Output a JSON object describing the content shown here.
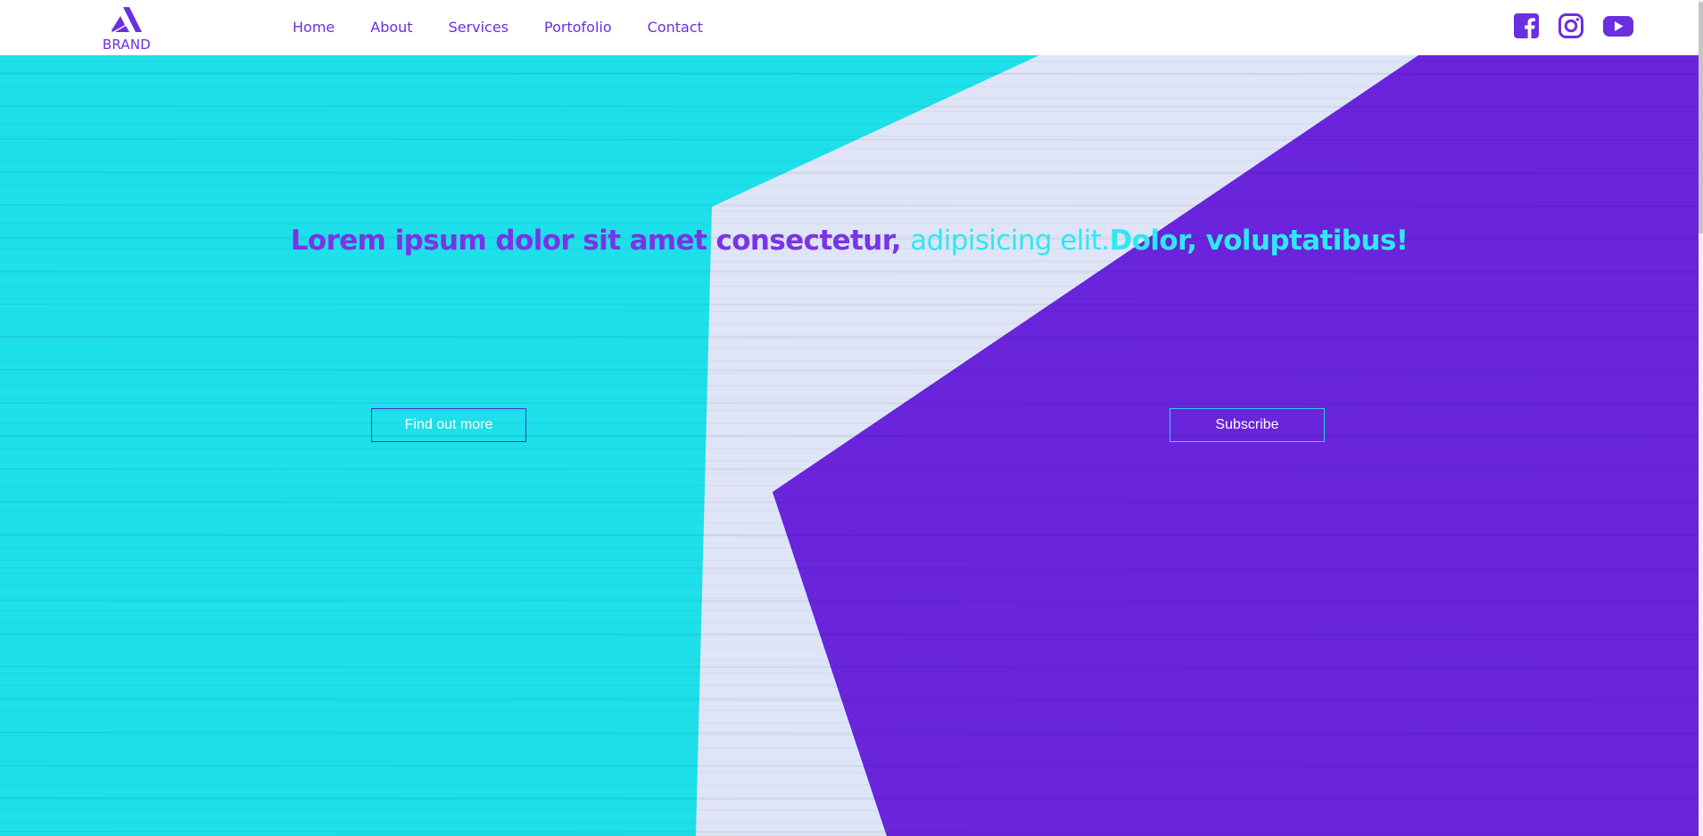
{
  "brand": {
    "name": "BRAND",
    "color": "#6a2fe0"
  },
  "nav": {
    "items": [
      {
        "label": "Home"
      },
      {
        "label": "About"
      },
      {
        "label": "Services"
      },
      {
        "label": "Portofolio"
      },
      {
        "label": "Contact"
      }
    ]
  },
  "social": {
    "icons": [
      "facebook-icon",
      "instagram-icon",
      "youtube-icon"
    ],
    "color": "#6a2fe0"
  },
  "hero": {
    "title_part1": "Lorem ipsum dolor sit amet consectetur, ",
    "title_part2": "adipisicing elit.",
    "title_part3": "Dolor, voluptatibus!",
    "find_out_more_label": "Find out more",
    "subscribe_label": "Subscribe",
    "colors": {
      "cyan": "#1ee0ea",
      "white_stripe": "#dfe5f7",
      "purple": "#6a24dc"
    }
  }
}
